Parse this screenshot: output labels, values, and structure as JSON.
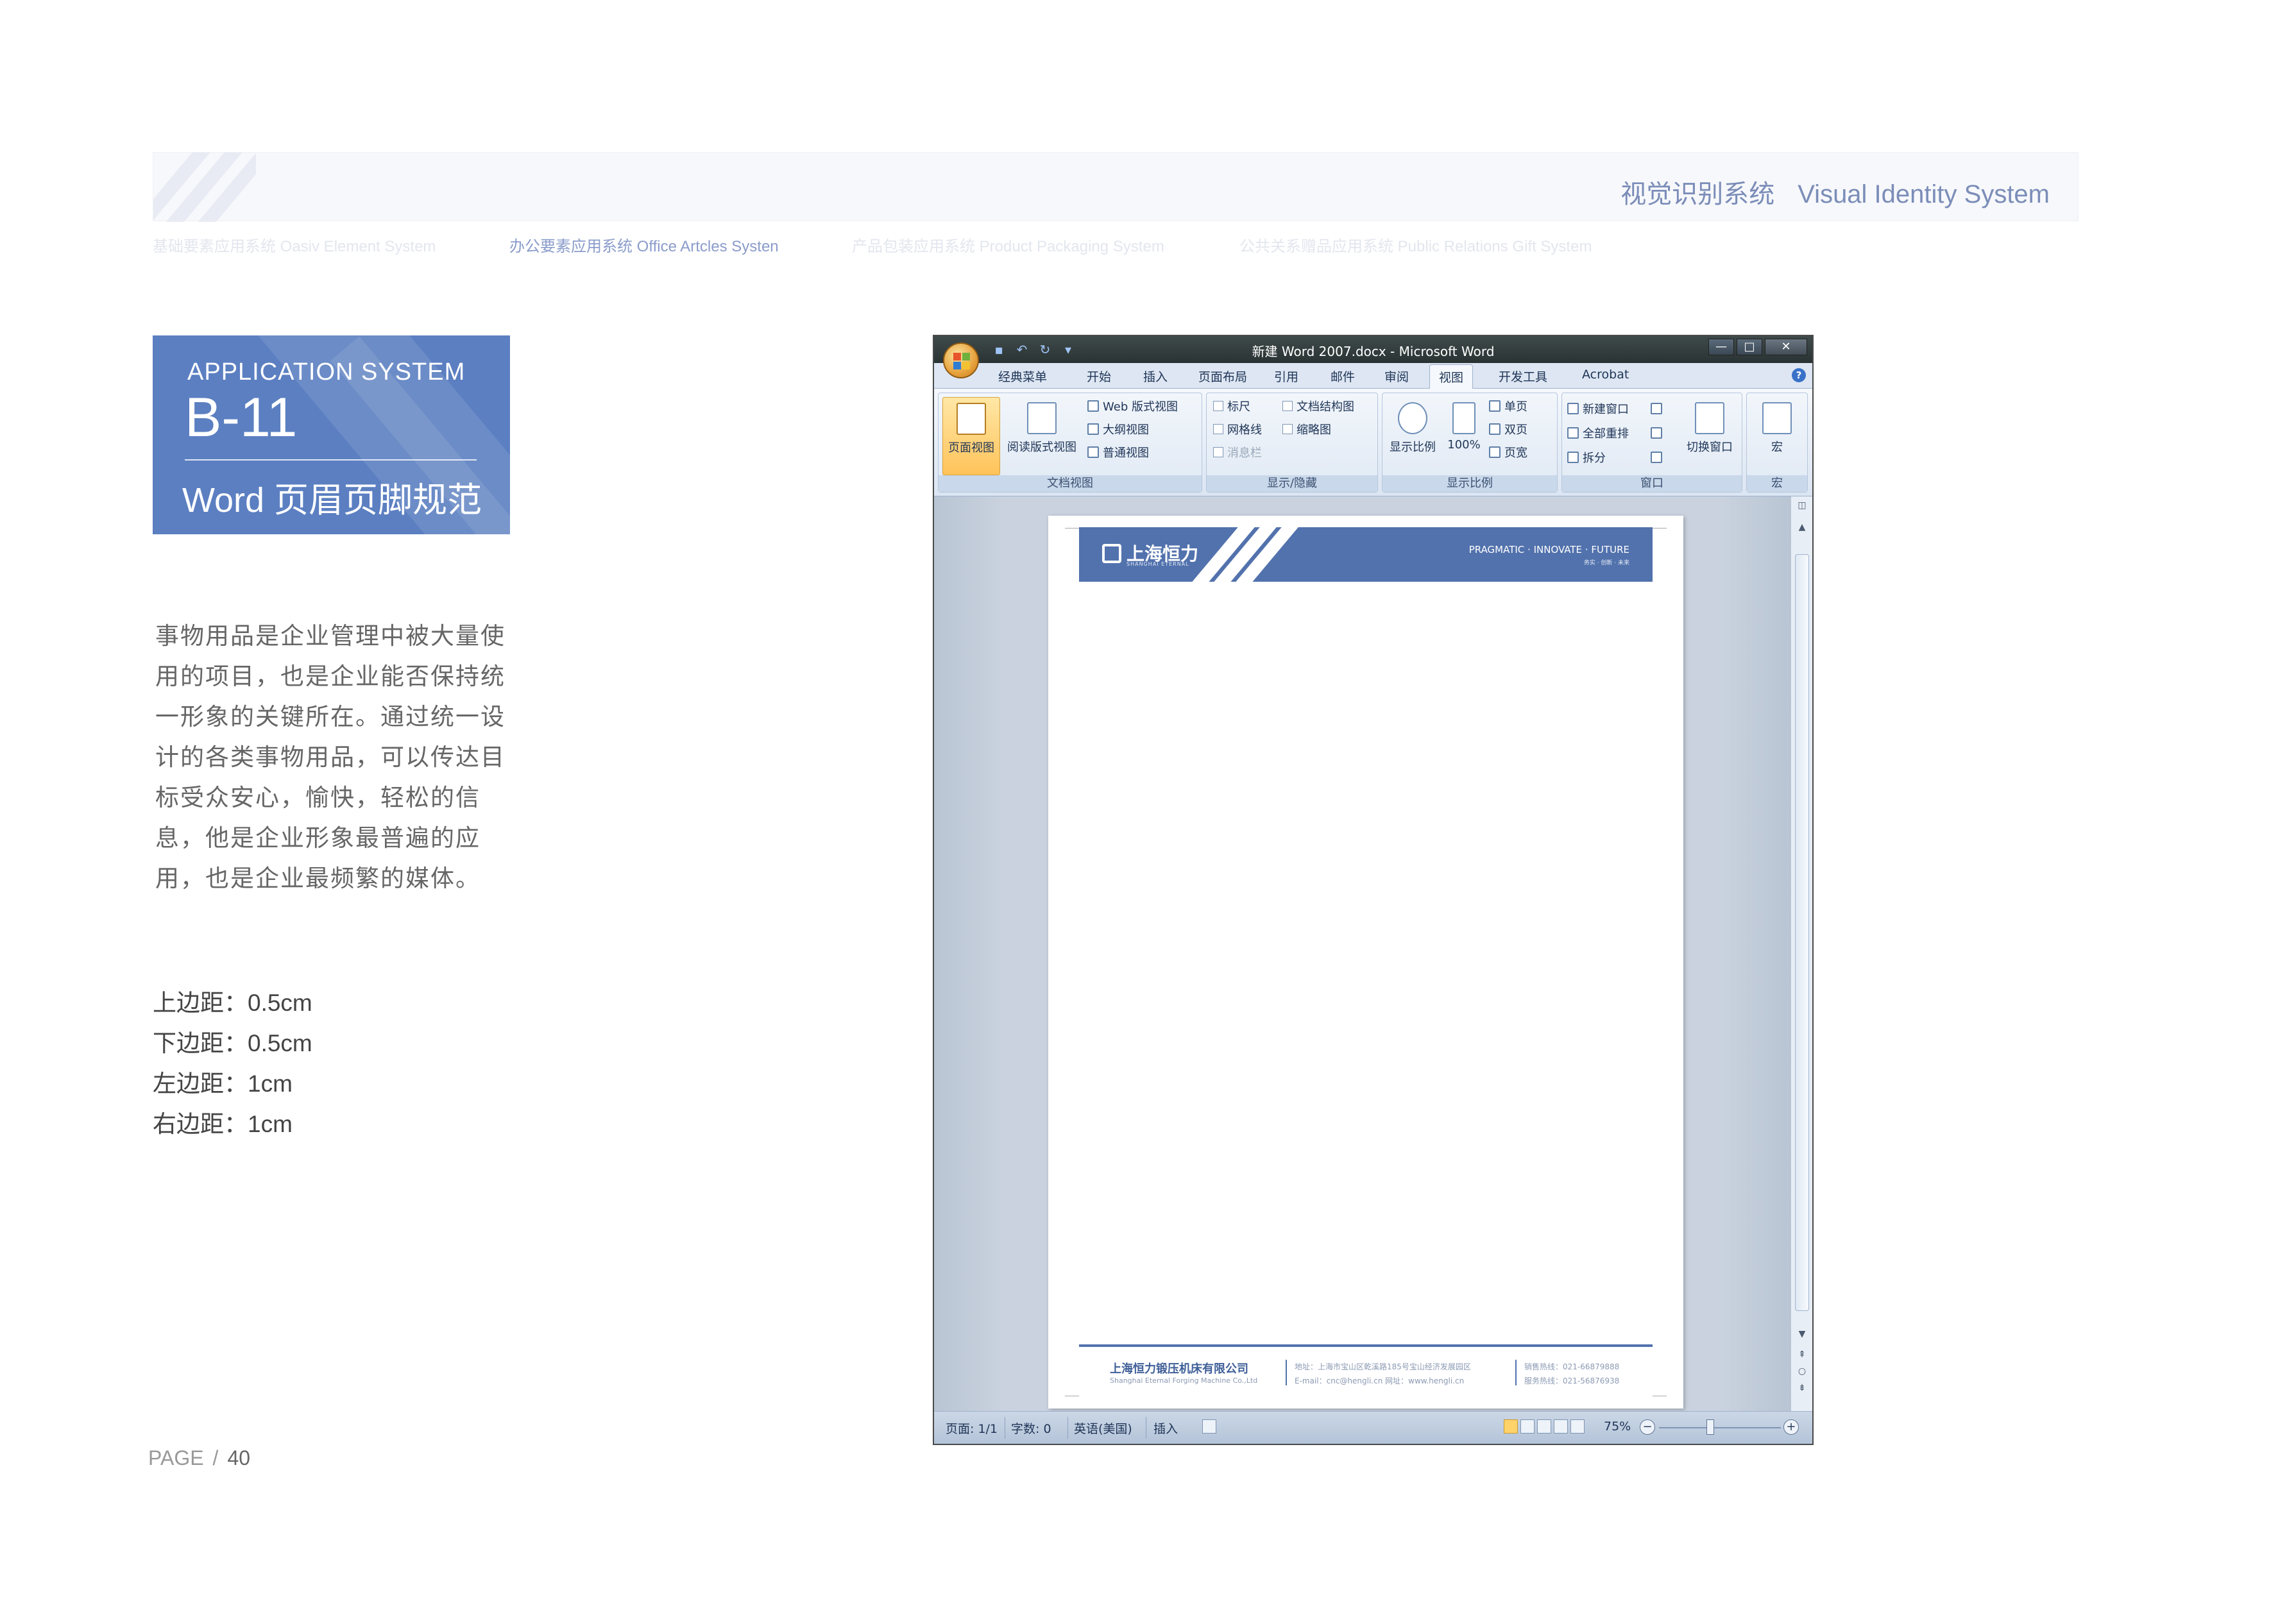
{
  "header": {
    "title_cn": "视觉识别系统",
    "title_en": "Visual Identity System",
    "nav": [
      {
        "label": "基础要素应用系统 Oasiv Element System",
        "active": false
      },
      {
        "label": "办公要素应用系统 Office Artcles Systen",
        "active": true
      },
      {
        "label": "产品包装应用系统 Product Packaging System",
        "active": false
      },
      {
        "label": "公共关系赠品应用系统 Public Relations Gift System",
        "active": false
      }
    ]
  },
  "badge": {
    "system": "APPLICATION SYSTEM",
    "code": "B-11",
    "name": "Word 页眉页脚规范"
  },
  "body_text": "事物用品是企业管理中被大量使用的项目，也是企业能否保持统一形象的关键所在。通过统一设计的各类事物用品，可以传达目标受众安心，愉快，轻松的信息，他是企业形象最普遍的应用，也是企业最频繁的媒体。",
  "margins": [
    "上边距：0.5cm",
    "下边距：0.5cm",
    "左边距：1cm",
    "右边距：1cm"
  ],
  "page_footer": {
    "label": "PAGE",
    "slash": "/",
    "number": "40"
  },
  "word": {
    "window_title": "新建 Word 2007.docx - Microsoft Word",
    "qat_icons": [
      "save-icon",
      "undo-icon",
      "redo-icon",
      "customize-icon"
    ],
    "window_controls": {
      "minimize": "—",
      "maximize": "□",
      "close": "✕"
    },
    "help": "?",
    "tabs": [
      "经典菜单",
      "开始",
      "插入",
      "页面布局",
      "引用",
      "邮件",
      "审阅",
      "视图",
      "开发工具",
      "Acrobat"
    ],
    "selected_tab": "视图",
    "ribbon": {
      "doc_views": {
        "label": "文档视图",
        "print_layout": "页面视图",
        "full_screen": "阅读版式视图",
        "web": "Web 版式视图",
        "outline": "大纲视图",
        "draft": "普通视图"
      },
      "show_hide": {
        "label": "显示/隐藏",
        "ruler": "标尺",
        "gridlines": "网格线",
        "message_bar": "消息栏",
        "doc_map": "文档结构图",
        "thumbnails": "缩略图"
      },
      "zoom": {
        "label": "显示比例",
        "zoom": "显示比例",
        "percent": "100%",
        "one_page": "单页",
        "two_pages": "双页",
        "page_width": "页宽"
      },
      "window": {
        "label": "窗口",
        "new_window": "新建窗口",
        "arrange_all": "全部重排",
        "split": "拆分",
        "switch": "切换窗口"
      },
      "macros": {
        "label": "宏",
        "macros": "宏"
      }
    },
    "document": {
      "logo_cn": "上海恒力",
      "logo_en": "SHANGHAI ETERNAL",
      "slogan": "PRAGMATIC · INNOVATE · FUTURE",
      "slogan_cn": "务实 · 创新 · 未来",
      "footer_company": "上海恒力锻压机床有限公司",
      "footer_company_en": "Shanghai Eternal Forging Machine Co.,Ltd",
      "footer_address": "地址：上海市宝山区乾溪路185号宝山经济发展园区",
      "footer_email": "E-mail：cnc@hengli.cn    网址：www.hengli.cn",
      "footer_sales": "销售热线：021-66879888",
      "footer_service": "服务热线：021-56876938"
    },
    "status": {
      "page": "页面: 1/1",
      "words": "字数: 0",
      "language": "英语(美国)",
      "insert": "插入",
      "zoom": "75%",
      "zoom_minus": "−",
      "zoom_plus": "+"
    }
  }
}
